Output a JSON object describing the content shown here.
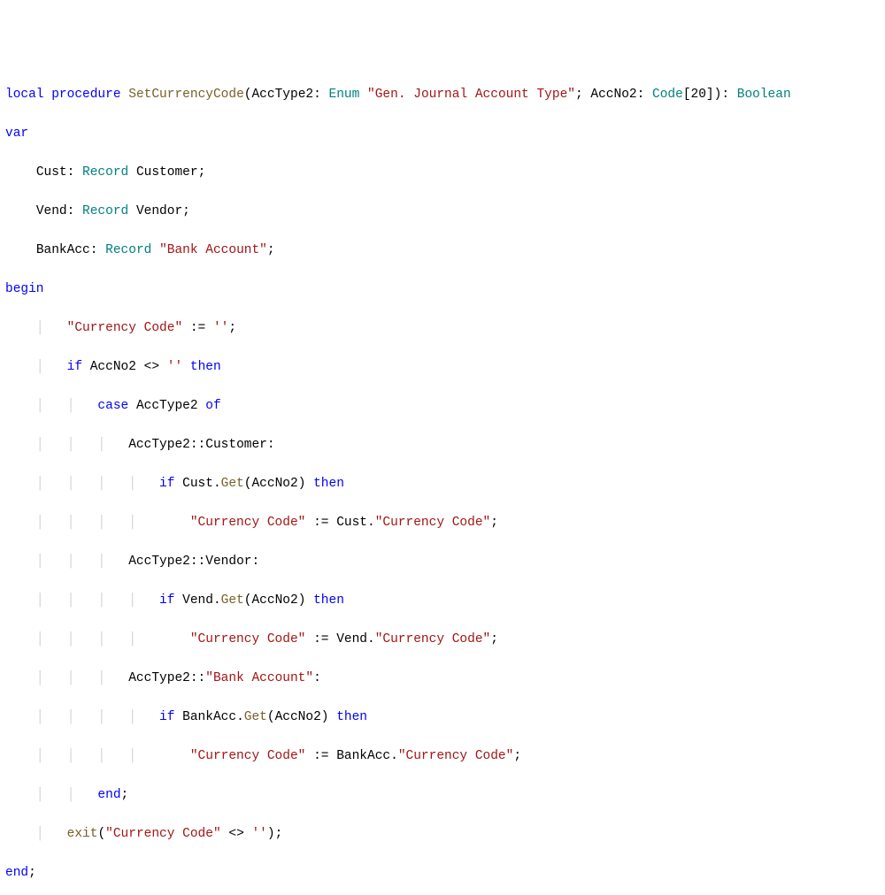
{
  "kw": {
    "local": "local",
    "procedure": "procedure",
    "var": "var",
    "begin": "begin",
    "if": "if",
    "then": "then",
    "case": "case",
    "of": "of",
    "end": "end",
    "exit": "exit"
  },
  "type": {
    "Enum": "Enum",
    "Code": "Code",
    "Boolean": "Boolean",
    "Record": "Record"
  },
  "func": {
    "SetCurrencyCode": "SetCurrencyCode",
    "Get": "Get"
  },
  "str": {
    "gjatype": "\"Gen. Journal Account Type\"",
    "bankacct": "\"Bank Account\"",
    "curcode": "\"Currency Code\"",
    "empty": "''",
    "code20": "[20]"
  },
  "id": {
    "AccType2": "AccType2",
    "AccNo2": "AccNo2",
    "Cust": "Cust",
    "Vend": "Vend",
    "BankAcc": "BankAcc",
    "Customer": "Customer",
    "Vendor": "Vendor"
  },
  "op": {
    "assign": ":=",
    "ne": "<>",
    "dcolon": "::",
    "colon": ":",
    "semi": ";",
    "lparen": "(",
    "rparen": ")",
    "dot": "."
  },
  "guide": {
    "one": "    │   ",
    "two": "    │   │   ",
    "three": "    │   │   │   ",
    "four": "    │   │   │   │   "
  },
  "indent": {
    "one": "    "
  }
}
